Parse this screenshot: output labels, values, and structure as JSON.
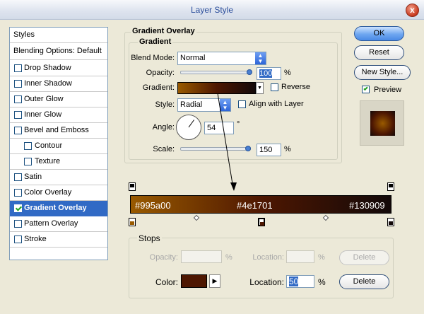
{
  "window": {
    "title": "Layer Style",
    "close_glyph": "x"
  },
  "sidebar": {
    "header": "Styles",
    "blending": "Blending Options: Default",
    "items": [
      {
        "label": "Drop Shadow",
        "checked": false
      },
      {
        "label": "Inner Shadow",
        "checked": false
      },
      {
        "label": "Outer Glow",
        "checked": false
      },
      {
        "label": "Inner Glow",
        "checked": false
      },
      {
        "label": "Bevel and Emboss",
        "checked": false
      },
      {
        "label": "Contour",
        "checked": false
      },
      {
        "label": "Texture",
        "checked": false
      },
      {
        "label": "Satin",
        "checked": false
      },
      {
        "label": "Color Overlay",
        "checked": false
      },
      {
        "label": "Gradient Overlay",
        "checked": true,
        "selected": true
      },
      {
        "label": "Pattern Overlay",
        "checked": false
      },
      {
        "label": "Stroke",
        "checked": false
      }
    ]
  },
  "panel": {
    "title": "Gradient Overlay",
    "group_title": "Gradient",
    "blend_mode": {
      "label": "Blend Mode:",
      "value": "Normal"
    },
    "opacity": {
      "label": "Opacity:",
      "value": "100",
      "unit": "%",
      "level": 1.0
    },
    "gradient": {
      "label": "Gradient:"
    },
    "reverse": {
      "label": "Reverse",
      "checked": false
    },
    "style": {
      "label": "Style:",
      "value": "Radial"
    },
    "align": {
      "label": "Align with Layer",
      "checked": false
    },
    "angle": {
      "label": "Angle:",
      "value": "54",
      "unit": "°"
    },
    "scale": {
      "label": "Scale:",
      "value": "150",
      "unit": "%",
      "level": 0.98
    }
  },
  "buttons": {
    "ok": "OK",
    "reset": "Reset",
    "new_style": "New Style...",
    "preview": "Preview",
    "preview_checked": true
  },
  "gradient_bar": {
    "labels": [
      "#995a00",
      "#4e1701",
      "#130909"
    ],
    "colors": {
      "start": "#995a00",
      "mid": "#4e1701",
      "end": "#130909"
    }
  },
  "stops": {
    "title": "Stops",
    "opacity_label": "Opacity:",
    "opacity_unit": "%",
    "location_label_top": "Location:",
    "location_unit_top": "%",
    "delete_top": "Delete",
    "color_label": "Color:",
    "location_label": "Location:",
    "location_value": "50",
    "location_unit": "%",
    "delete": "Delete"
  },
  "colors": {
    "selection": "#316ac5",
    "accent": "#2b4e9b"
  }
}
